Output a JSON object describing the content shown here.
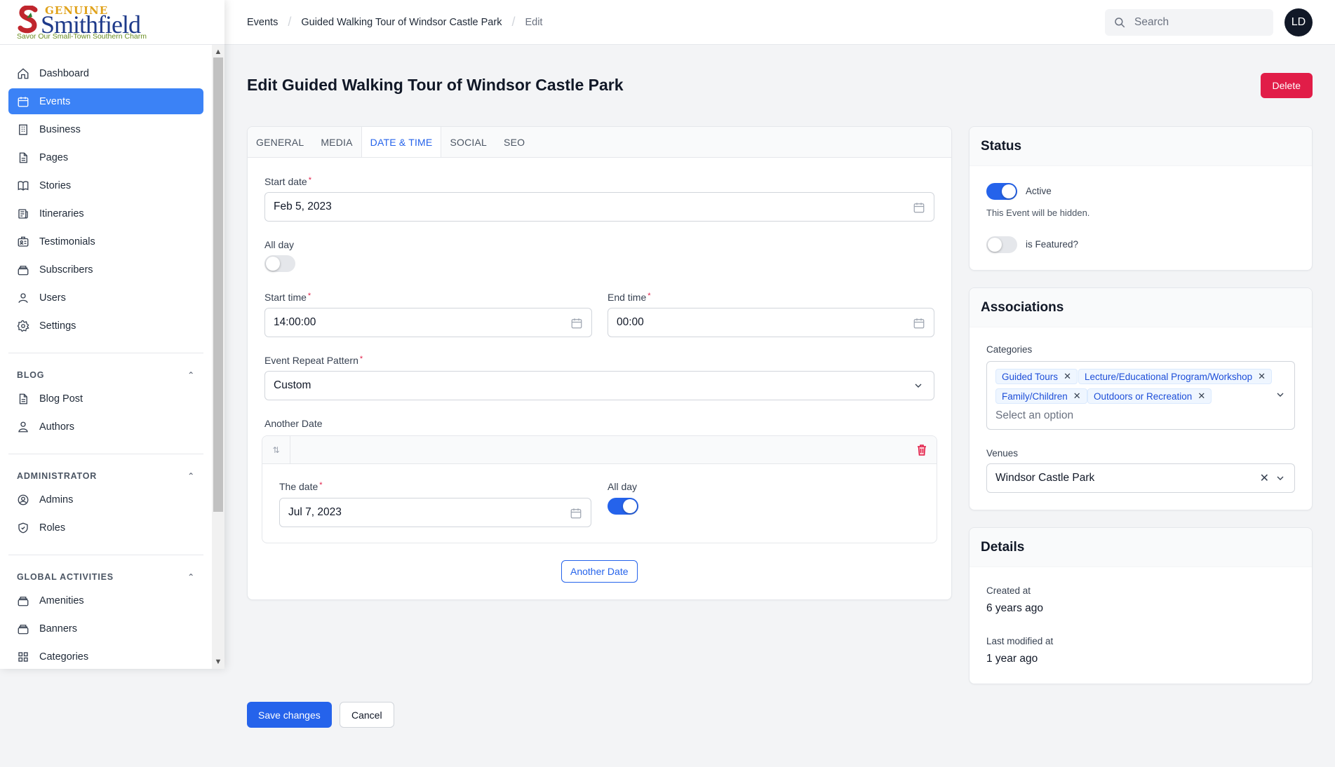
{
  "brand": {
    "logo_top": "GENUINE",
    "logo_main": "Smithfield",
    "tagline": "Savor Our Small-Town Southern Charm"
  },
  "sidebar": {
    "items": [
      {
        "label": "Dashboard",
        "icon": "home-icon"
      },
      {
        "label": "Events",
        "icon": "calendar-icon",
        "active": true
      },
      {
        "label": "Business",
        "icon": "building-icon"
      },
      {
        "label": "Pages",
        "icon": "document-icon"
      },
      {
        "label": "Stories",
        "icon": "book-icon"
      },
      {
        "label": "Itineraries",
        "icon": "newspaper-icon"
      },
      {
        "label": "Testimonials",
        "icon": "id-card-icon"
      },
      {
        "label": "Subscribers",
        "icon": "collection-icon"
      },
      {
        "label": "Users",
        "icon": "user-icon"
      },
      {
        "label": "Settings",
        "icon": "gear-icon"
      }
    ],
    "groups": [
      {
        "title": "BLOG",
        "items": [
          {
            "label": "Blog Post",
            "icon": "document-icon"
          },
          {
            "label": "Authors",
            "icon": "users-icon"
          }
        ]
      },
      {
        "title": "ADMINISTRATOR",
        "items": [
          {
            "label": "Admins",
            "icon": "user-circle-icon"
          },
          {
            "label": "Roles",
            "icon": "shield-icon"
          }
        ]
      },
      {
        "title": "GLOBAL ACTIVITIES",
        "items": [
          {
            "label": "Amenities",
            "icon": "collection-icon"
          },
          {
            "label": "Banners",
            "icon": "collection-icon"
          },
          {
            "label": "Categories",
            "icon": "grid-icon"
          }
        ]
      }
    ]
  },
  "topbar": {
    "breadcrumbs": [
      "Events",
      "Guided Walking Tour of Windsor Castle Park",
      "Edit"
    ],
    "search_placeholder": "Search",
    "avatar_initials": "LD"
  },
  "page": {
    "title": "Edit Guided Walking Tour of Windsor Castle Park",
    "delete_label": "Delete"
  },
  "form": {
    "tabs": [
      "GENERAL",
      "MEDIA",
      "DATE & TIME",
      "SOCIAL",
      "SEO"
    ],
    "active_tab": "DATE & TIME",
    "start_date_label": "Start date",
    "start_date": "Feb 5, 2023",
    "all_day_label": "All day",
    "all_day": false,
    "start_time_label": "Start time",
    "start_time": "14:00:00",
    "end_time_label": "End time",
    "end_time": "00:00",
    "repeat_label": "Event Repeat Pattern",
    "repeat_value": "Custom",
    "another_date_label": "Another Date",
    "repeater": {
      "date_label": "The date",
      "date_value": "Jul 7, 2023",
      "all_day_label": "All day",
      "all_day": true
    },
    "add_another_label": "Another Date"
  },
  "status": {
    "title": "Status",
    "active_label": "Active",
    "active": true,
    "hint": "This Event will be hidden.",
    "featured_label": "is Featured?",
    "featured": false
  },
  "associations": {
    "title": "Associations",
    "categories_label": "Categories",
    "categories": [
      "Guided Tours",
      "Lecture/Educational Program/Workshop",
      "Family/Children",
      "Outdoors or Recreation"
    ],
    "categories_placeholder": "Select an option",
    "venues_label": "Venues",
    "venue": "Windsor Castle Park"
  },
  "details": {
    "title": "Details",
    "created_label": "Created at",
    "created_value": "6 years ago",
    "modified_label": "Last modified at",
    "modified_value": "1 year ago"
  },
  "footer": {
    "save_label": "Save changes",
    "cancel_label": "Cancel"
  },
  "colors": {
    "primary": "#2563eb",
    "danger": "#e11d48",
    "active_nav": "#3b82f6"
  }
}
